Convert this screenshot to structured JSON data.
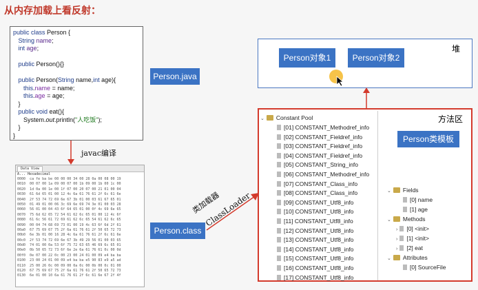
{
  "title": "从内存加载上看反射：",
  "watermark": "",
  "code": {
    "lines": [
      [
        "kw:public class ",
        "t:Person {"
      ],
      [
        "t:   ",
        "kw:String ",
        "vn:name",
        "t:;"
      ],
      [
        "t:   ",
        "kw:int ",
        "vn:age",
        "t:;"
      ],
      [
        "t:"
      ],
      [
        "t:   ",
        "kw:public ",
        "t:Person(){}"
      ],
      [
        "t:"
      ],
      [
        "t:   ",
        "kw:public ",
        "t:Person(",
        "kw:String ",
        "t:name,",
        "kw:int ",
        "t:age){"
      ],
      [
        "t:      ",
        "kw:this",
        "t:.",
        "fld:name",
        "t: = name;"
      ],
      [
        "t:      ",
        "kw:this",
        "t:.",
        "fld:age",
        "t: = age;"
      ],
      [
        "t:   }"
      ],
      [
        "t:   ",
        "kw:public void ",
        "t:eat(){"
      ],
      [
        "t:      System.",
        "it:out",
        "t:.println(",
        "str:\"人吃饭\"",
        "t:);"
      ],
      [
        "t:   }"
      ],
      [
        "t:}"
      ]
    ]
  },
  "labels": {
    "person_java": "Person.java",
    "person_class": "Person.class",
    "javac": "javac编译",
    "classloader_cn": "类加载器",
    "classloader_en": "ClassLoader",
    "heap": "堆",
    "method_area": "方法区",
    "obj1": "Person对象1",
    "obj2": "Person对象2",
    "template": "Person类模板"
  },
  "hex": {
    "tab": "Data View",
    "header": "A...  Hexadecimal",
    "rows": [
      "0000  ca fe ba be 00 00 00 34 00 28 0a 00 08 00 19",
      "0010  00 07 00 1a 09 00 07 00 1b 09 00 1b 00 1c 00",
      "0020  1d 0a 00 1e 00 1f 07 00 20 07 00 21 01 00 04",
      "0030  61 6d 65 01 00 12 4c 6a 61 76 61 2f 6c 61 6e",
      "0040  2f 53 74 72 69 6e 67 3b 01 00 03 61 67 65 01",
      "0050  01 49 01 00 06 3c 69 6e 69 74 3e 01 00 03 28",
      "0060  56 01 00 04 43 6f 64 65 01 00 0f 4c 69 6e 65",
      "0070  75 6d 62 65 72 54 61 62 6c 65 01 00 12 4c 6f",
      "0080  61 6c 56 61 72 69 61 62 6c 65 54 61 62 6c 65",
      "0090  00 04 74 68 69 73 01 00 19 4c 63 6f 6d 2f 61",
      "00a0  67 75 69 67 75 2f 6a 61 76 61 2f 50 65 72 73",
      "00b0  6e 3b 01 00 16 28 4c 6a 61 76 61 2f 6c 61 6e",
      "00c0  2f 53 74 72 69 6e 67 3b 49 29 56 01 00 03 65",
      "00d0  74 01 00 0a 53 6f 75 72 63 65 46 69 6c 65 01",
      "00e0  0b 50 65 72 73 6f 6e 2e 6a 61 76 61 0c 00 0d",
      "00f0  0e 07 00 22 0c 00 23 00 24 01 00 09 e4 ba ba",
      "0100  23 00 24 01 00 09 e4 ba ba e5 90 83 e9 a5 ad",
      "0110  25 00 26 0c 00 09 00 0a 0c 00 0b 00 0c 01 00",
      "0120  67 75 69 67 75 2f 6a 61 76 61 2f 50 65 72 73",
      "0130  6e 01 00 10 6a 61 76 61 2f 6c 61 6e 67 2f 4f"
    ]
  },
  "constant_pool": {
    "root": "Constant Pool",
    "items": [
      "[01] CONSTANT_Methodref_info",
      "[02] CONSTANT_Fieldref_info",
      "[03] CONSTANT_Fieldref_info",
      "[04] CONSTANT_Fieldref_info",
      "[05] CONSTANT_String_info",
      "[06] CONSTANT_Methodref_info",
      "[07] CONSTANT_Class_info",
      "[08] CONSTANT_Class_info",
      "[09] CONSTANT_Utf8_info",
      "[10] CONSTANT_Utf8_info",
      "[11] CONSTANT_Utf8_info",
      "[12] CONSTANT_Utf8_info",
      "[13] CONSTANT_Utf8_info",
      "[14] CONSTANT_Utf8_info",
      "[15] CONSTANT_Utf8_info",
      "[16] CONSTANT_Utf8_info",
      "[17] CONSTANT_Utf8_info"
    ]
  },
  "tree": {
    "fields": "Fields",
    "field_items": [
      "[0] name",
      "[1] age"
    ],
    "methods": "Methods",
    "method_items": [
      "[0] <init>",
      "[1] <init>",
      "[2] eat"
    ],
    "attributes": "Attributes",
    "attr_items": [
      "[0] SourceFile"
    ]
  },
  "colors": {
    "accent_blue": "#3b73c4",
    "method_area_border": "#d33a2c",
    "title_red": "#c0392b"
  }
}
